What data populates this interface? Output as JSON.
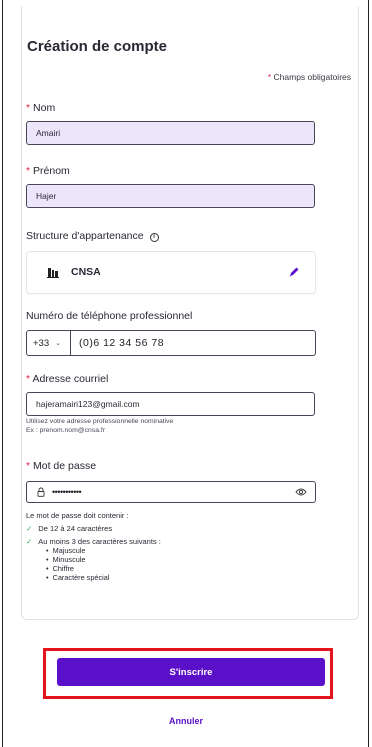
{
  "form": {
    "title": "Création de compte",
    "required_star": "*",
    "required_note": "Champs obligatoires"
  },
  "fields": {
    "nom": {
      "label": "Nom",
      "value": "Amairi"
    },
    "prenom": {
      "label": "Prénom",
      "value": "Hajer"
    },
    "structure": {
      "label": "Structure d'appartenance",
      "info": "i",
      "value": "CNSA"
    },
    "phone": {
      "label": "Numéro de téléphone professionnel",
      "code": "+33",
      "value": "(0)6 12 34 56 78"
    },
    "email": {
      "label": "Adresse courriel",
      "value": "hajeramairi123@gmail.com",
      "help_line1": "Utilisez votre adresse professionnelle nominative",
      "help_line2": "Ex : prenom.nom@cnsa.fr"
    },
    "password": {
      "label": "Mot de passe",
      "value": "•••••••••••"
    }
  },
  "password_rules": {
    "heading": "Le mot de passe doit contenir :",
    "rule1": "De 12 à 24 caractères",
    "rule2": "Au moins 3 des caractères suivants :",
    "items": [
      "Majuscule",
      "Minuscule",
      "Chiffre",
      "Caractère spécial"
    ]
  },
  "actions": {
    "submit": "S'inscrire",
    "cancel": "Annuler"
  },
  "colors": {
    "primary": "#5a0fc8",
    "required": "#e2254a",
    "input_fill": "#ece6fb",
    "highlight": "#e3141b",
    "check": "#3aa35b"
  },
  "icons": [
    "info-icon",
    "building-icon",
    "pencil-icon",
    "chevron-down-icon",
    "lock-icon",
    "eye-icon",
    "check-icon"
  ]
}
